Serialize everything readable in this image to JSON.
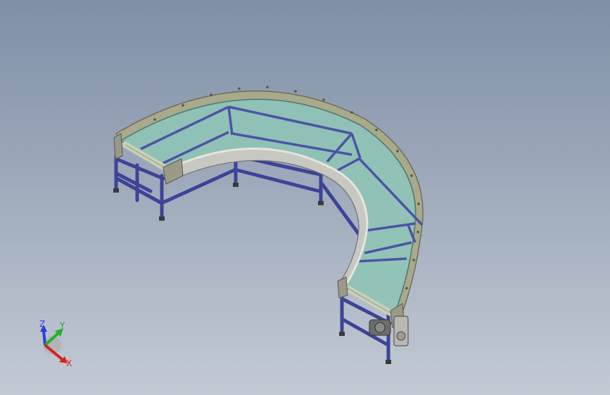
{
  "viewport": {
    "background_top": "#7f8fa6",
    "background_bottom": "#c3cad4"
  },
  "model": {
    "belt_color": "#8fc4b6",
    "frame_color": "#4c53a6",
    "guard_color": "#a7a88a",
    "roller_color": "#c9d0b8"
  },
  "triad": {
    "x_label": "X",
    "y_label": "Y",
    "z_label": "Z",
    "x_color": "#d42020",
    "y_color": "#22b028",
    "z_color": "#2a3fd8"
  }
}
